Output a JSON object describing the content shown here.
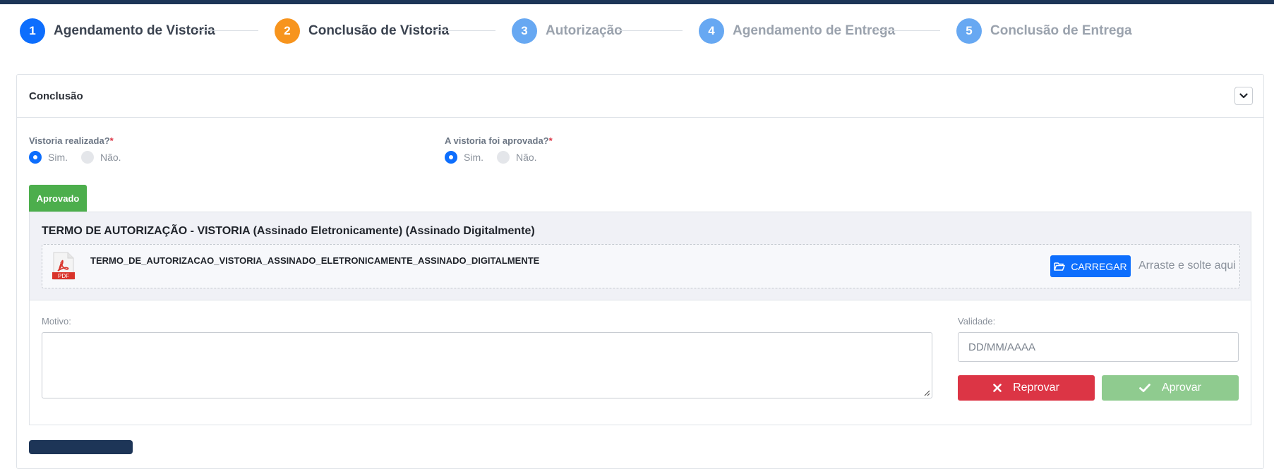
{
  "stepper": {
    "steps": [
      {
        "number": "1",
        "label": "Agendamento de Vistoria",
        "state": "done"
      },
      {
        "number": "2",
        "label": "Conclusão de Vistoria",
        "state": "current"
      },
      {
        "number": "3",
        "label": "Autorização",
        "state": "todo"
      },
      {
        "number": "4",
        "label": "Agendamento de Entrega",
        "state": "todo"
      },
      {
        "number": "5",
        "label": "Conclusão de Entrega",
        "state": "todo"
      }
    ]
  },
  "card": {
    "title": "Conclusão",
    "collapse_icon": "chevron-down-icon"
  },
  "questions": {
    "vistoria_realizada": {
      "label": "Vistoria realizada?",
      "required_mark": "*",
      "options": [
        "Sim.",
        "Não."
      ],
      "selected": "Sim."
    },
    "vistoria_aprovada": {
      "label": "A vistoria foi aprovada?",
      "required_mark": "*",
      "options": [
        "Sim.",
        "Não."
      ],
      "selected": "Sim."
    }
  },
  "status_tab": {
    "label": "Aprovado",
    "color": "#4cae4c"
  },
  "document": {
    "title": "TERMO DE AUTORIZAÇÃO - VISTORIA (Assinado Eletronicamente) (Assinado Digitalmente)",
    "file_type": "PDF",
    "file_name": "TERMO_DE_AUTORIZACAO_VISTORIA_ASSINADO_ELETRONICAMENTE_ASSINADO_DIGITALMENTE",
    "upload_label": "CARREGAR",
    "drop_hint": "Arraste e solte aqui"
  },
  "form": {
    "motivo_label": "Motivo:",
    "motivo_value": "",
    "validade_label": "Validade:",
    "validade_placeholder": "DD/MM/AAAA",
    "reject_label": "Reprovar",
    "approve_label": "Aprovar"
  },
  "colors": {
    "primary": "#0d6efd",
    "current_step": "#f7941d",
    "pending_step": "#67a8f2",
    "danger": "#dc3545",
    "success_disabled": "#8fcb8f",
    "navy": "#1d3557"
  }
}
